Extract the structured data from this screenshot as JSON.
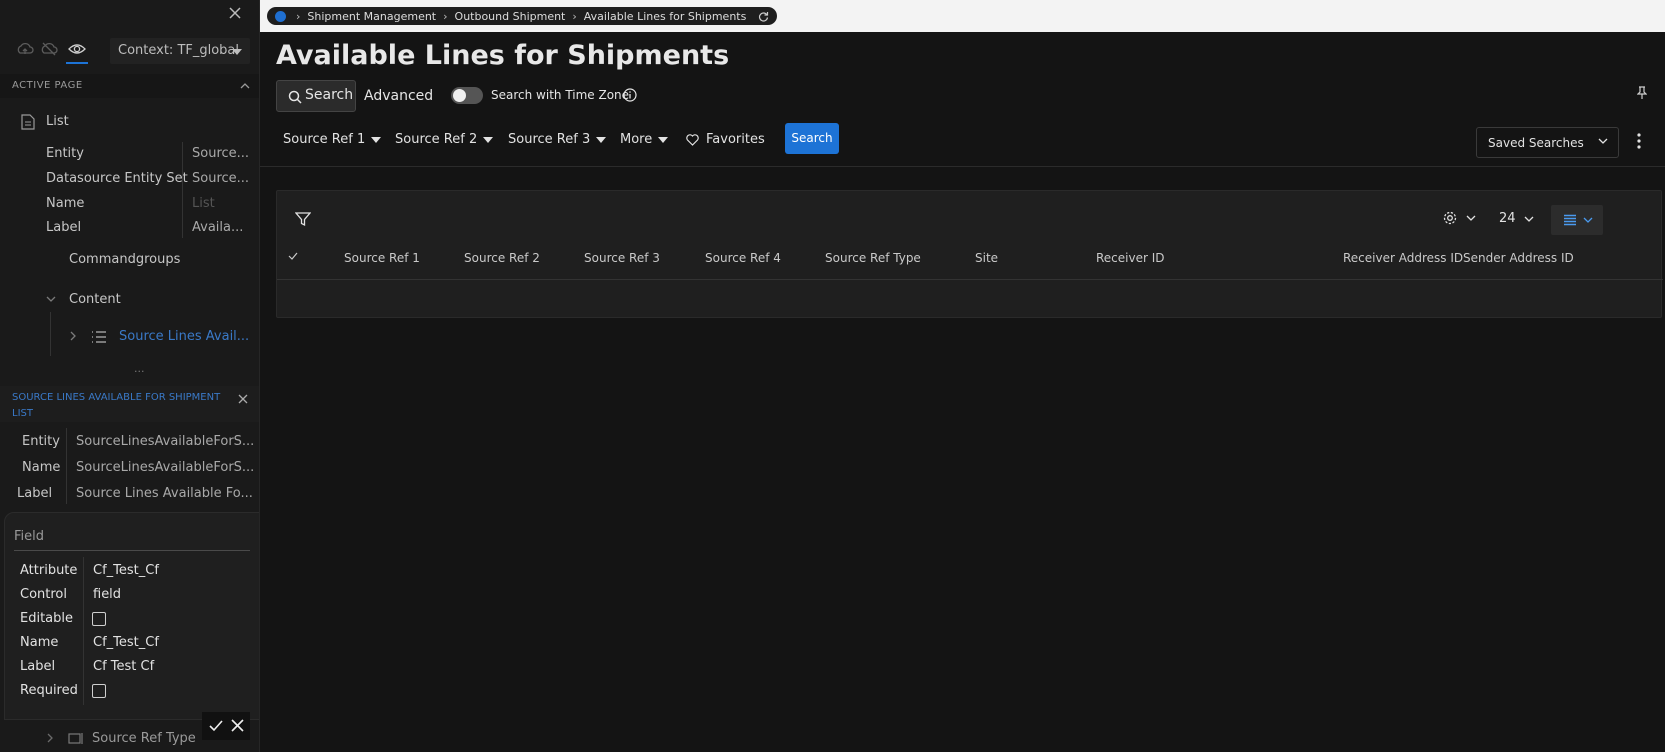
{
  "left_panel": {
    "context_label": "Context: TF_global",
    "active_page_title": "ACTIVE PAGE",
    "list_label": "List",
    "properties": [
      {
        "key": "Entity",
        "value": "Source..."
      },
      {
        "key": "Datasource Entity Set",
        "value": "Source..."
      },
      {
        "key": "Name",
        "value": "List"
      },
      {
        "key": "Label",
        "value": "Availa..."
      }
    ],
    "commandgroups": "Commandgroups",
    "content": "Content",
    "source_lines_item": "Source Lines Avail...",
    "ellipsis": "...",
    "selection_title": "SOURCE LINES AVAILABLE FOR SHIPMENT LIST",
    "selection_props": [
      {
        "key": "Entity",
        "value": "SourceLinesAvailableForS..."
      },
      {
        "key": "Name",
        "value": "SourceLinesAvailableForS..."
      },
      {
        "key": "Label",
        "value": "Source Lines Available Fo..."
      }
    ],
    "source_ref_type_item": "Source Ref Type"
  },
  "field_popup": {
    "title": "Field",
    "attribute_key": "Attribute",
    "attribute_value": "Cf_Test_Cf",
    "control_key": "Control",
    "control_value": "field",
    "editable_key": "Editable",
    "name_key": "Name",
    "name_value": "Cf_Test_Cf",
    "label_key": "Label",
    "label_value": "Cf Test Cf",
    "required_key": "Required"
  },
  "breadcrumb": [
    "Shipment Management",
    "Outbound Shipment",
    "Available Lines for Shipments"
  ],
  "page_title": "Available Lines for Shipments",
  "search": {
    "search_button": "Search",
    "advanced": "Advanced",
    "timezone_label": "Search with Time Zone",
    "filters": [
      "Source Ref 1",
      "Source Ref 2",
      "Source Ref 3",
      "More"
    ],
    "favorites": "Favorites",
    "go_button": "Search",
    "saved_searches": "Saved Searches"
  },
  "grid": {
    "page_size": "24",
    "columns": [
      "Source Ref 1",
      "Source Ref 2",
      "Source Ref 3",
      "Source Ref 4",
      "Source Ref Type",
      "Site",
      "Receiver ID",
      "Receiver Address ID",
      "Sender Address ID"
    ]
  },
  "colors": {
    "accent": "#1d73d6",
    "link": "#3a79c7",
    "background": "#141414"
  }
}
